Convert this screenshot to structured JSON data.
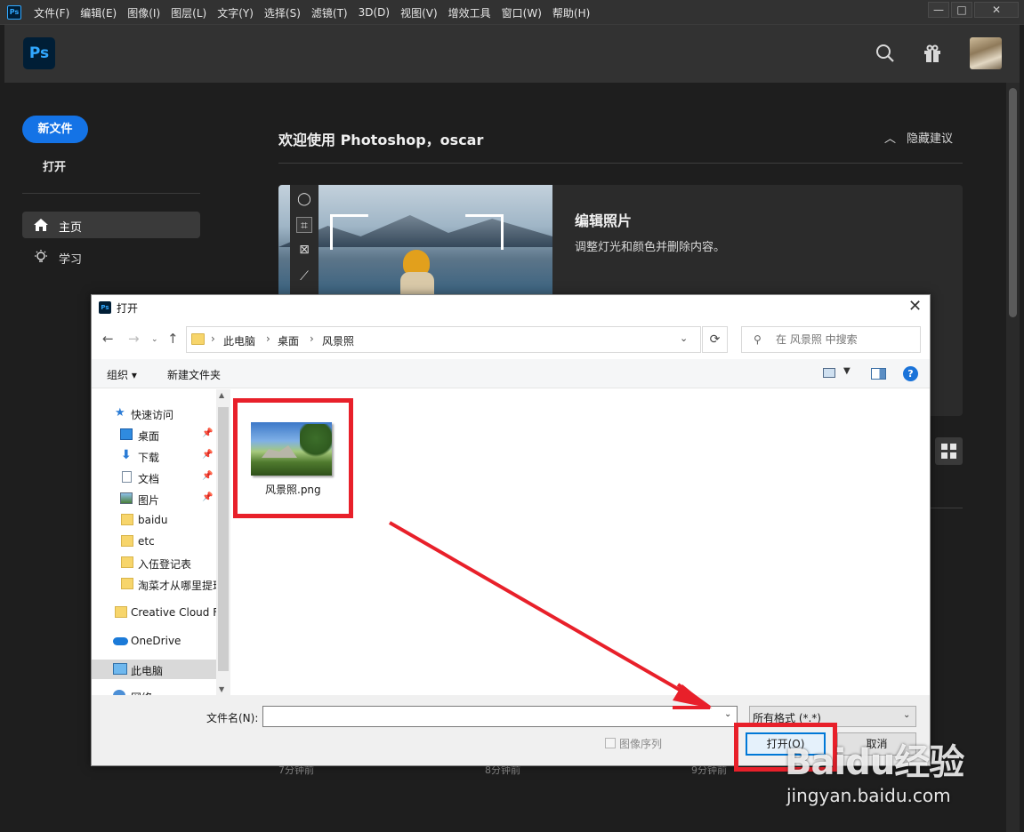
{
  "menubar": {
    "app_icon": "ps-icon",
    "items": [
      "文件(F)",
      "编辑(E)",
      "图像(I)",
      "图层(L)",
      "文字(Y)",
      "选择(S)",
      "滤镜(T)",
      "3D(D)",
      "视图(V)",
      "增效工具",
      "窗口(W)",
      "帮助(H)"
    ],
    "window_controls": [
      "—",
      "□",
      "✕"
    ]
  },
  "header": {
    "logo": "Ps",
    "icons": [
      "search-icon",
      "gift-icon",
      "avatar"
    ]
  },
  "sidebar": {
    "new_file": "新文件",
    "open": "打开",
    "nav": [
      {
        "label": "主页",
        "icon": "home-icon",
        "selected": true
      },
      {
        "label": "学习",
        "icon": "lightbulb-icon",
        "selected": false
      }
    ]
  },
  "main": {
    "welcome": "欢迎使用 Photoshop，oscar",
    "hide_suggestions": "隐藏建议",
    "card": {
      "title": "编辑照片",
      "description": "调整灯光和颜色并删除内容。"
    },
    "recent_times": [
      "7分钟前",
      "8分钟前",
      "9分钟前"
    ]
  },
  "dialog": {
    "title": "打开",
    "breadcrumb": [
      "此电脑",
      "桌面",
      "风景照"
    ],
    "search_placeholder": "在 风景照 中搜索",
    "toolbar": {
      "organize": "组织 ▾",
      "new_folder": "新建文件夹",
      "help": "?"
    },
    "nav_items": [
      {
        "label": "快速访问",
        "icon": "star-icon"
      },
      {
        "label": "桌面",
        "icon": "desktop-icon",
        "pinned": true
      },
      {
        "label": "下载",
        "icon": "download-icon",
        "pinned": true
      },
      {
        "label": "文档",
        "icon": "document-icon",
        "pinned": true
      },
      {
        "label": "图片",
        "icon": "picture-icon",
        "pinned": true
      },
      {
        "label": "baidu",
        "icon": "folder-icon"
      },
      {
        "label": "etc",
        "icon": "folder-icon"
      },
      {
        "label": "入伍登记表",
        "icon": "folder-icon"
      },
      {
        "label": "淘菜才从哪里提现",
        "icon": "folder-icon"
      },
      {
        "label": "Creative Cloud Files",
        "icon": "creative-cloud-icon"
      },
      {
        "label": "OneDrive",
        "icon": "onedrive-icon"
      },
      {
        "label": "此电脑",
        "icon": "computer-icon",
        "selected": true
      },
      {
        "label": "网络",
        "icon": "network-icon"
      }
    ],
    "files": [
      {
        "name": "风景照.png"
      }
    ],
    "filename_label": "文件名(N):",
    "filename_value": "",
    "filetype": "所有格式 (*.*)",
    "image_sequence": "图像序列",
    "open_button": "打开(O)",
    "cancel_button": "取消"
  },
  "watermark": {
    "logo": "Baidu经验",
    "url": "jingyan.baidu.com"
  },
  "colors": {
    "accent": "#1473e6",
    "annotation": "#e8202a",
    "dialog_focus": "#0078d7"
  }
}
